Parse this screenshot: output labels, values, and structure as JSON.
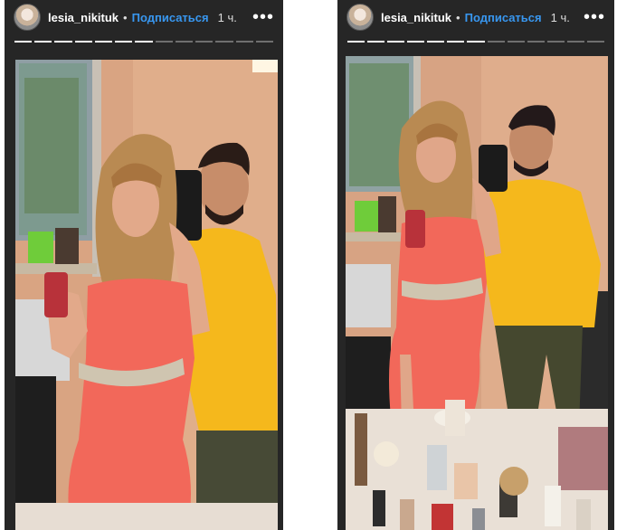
{
  "stories": [
    {
      "username": "lesia_nikituk",
      "separator": "•",
      "follow_label": "Подписаться",
      "time": "1 ч.",
      "more": "•••",
      "progress": {
        "total_segments": 13,
        "completed_segments": 7
      }
    },
    {
      "username": "lesia_nikituk",
      "separator": "•",
      "follow_label": "Подписаться",
      "time": "1 ч.",
      "more": "•••",
      "progress": {
        "total_segments": 13,
        "completed_segments": 7
      }
    }
  ],
  "colors": {
    "background": "#262626",
    "follow": "#3897f0",
    "dress": "#f2685a",
    "hoodie": "#f5b81c"
  }
}
